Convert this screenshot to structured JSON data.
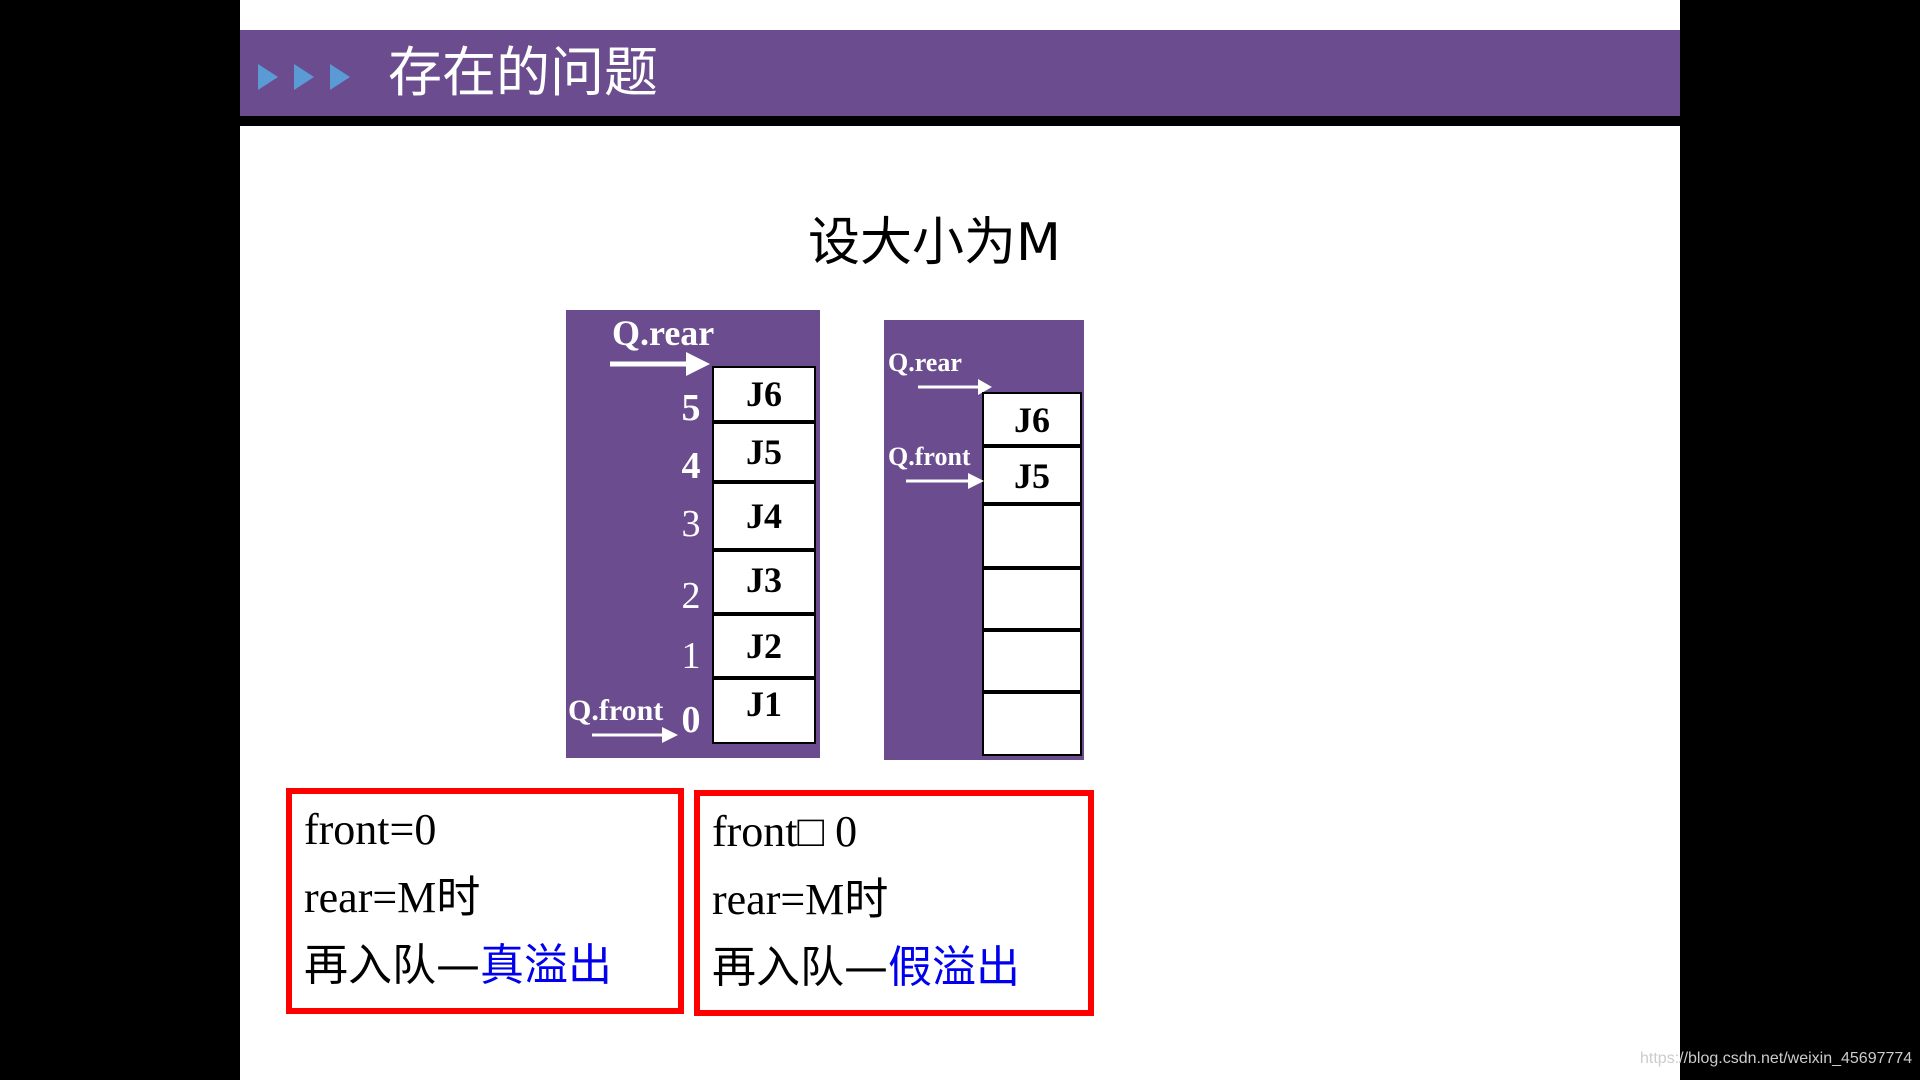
{
  "slide": {
    "title": "存在的问题",
    "subtitle": "设大小为M",
    "title_icons": [
      "play-triangle-icon",
      "play-triangle-icon",
      "play-triangle-icon"
    ]
  },
  "left_queue": {
    "rear_label": "Q.rear",
    "front_label": "Q.front",
    "slots": [
      {
        "index": "5",
        "value": "J6"
      },
      {
        "index": "4",
        "value": "J5"
      },
      {
        "index": "3",
        "value": "J4"
      },
      {
        "index": "2",
        "value": "J3"
      },
      {
        "index": "1",
        "value": "J2"
      },
      {
        "index": "0",
        "value": "J1"
      }
    ]
  },
  "right_queue": {
    "rear_label": "Q.rear",
    "front_label": "Q.front",
    "slots": [
      {
        "value": "J6"
      },
      {
        "value": "J5"
      },
      {
        "value": ""
      },
      {
        "value": ""
      },
      {
        "value": ""
      },
      {
        "value": ""
      }
    ]
  },
  "notes": [
    {
      "line1": "front=0",
      "line2_prefix": "rear=M",
      "line2_suffix": "时",
      "line3_prefix": "再入队—",
      "line3_highlight": "真溢出"
    },
    {
      "line1": "front□ 0",
      "line2_prefix": "rear=M",
      "line2_suffix": "时",
      "line3_prefix": "再入队—",
      "line3_highlight": "假溢出"
    }
  ],
  "watermark": "https://blog.csdn.net/weixin_45697774",
  "colors": {
    "panel": "#6b4c8f",
    "title_icon": "#5b9bd5",
    "note_border": "#ff0000",
    "highlight_text": "#0000ee"
  }
}
